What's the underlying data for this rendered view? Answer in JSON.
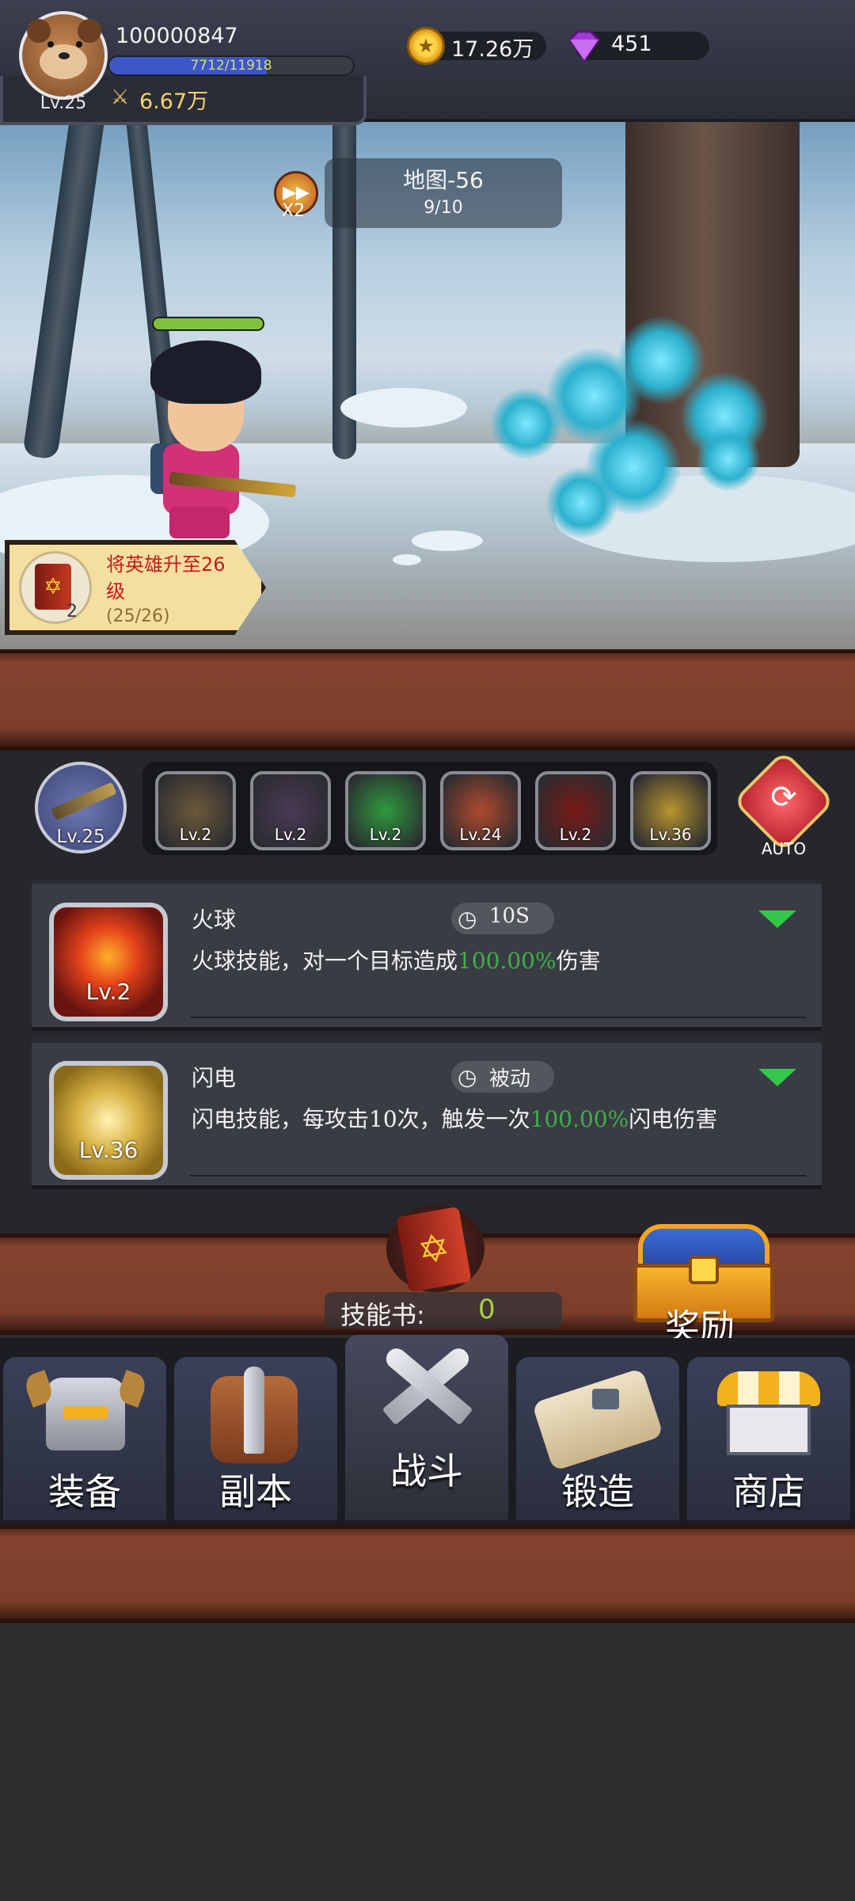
{
  "player": {
    "id": "100000847",
    "level": "Lv.25",
    "exp_text": "7712/11918",
    "exp_fraction": 0.647,
    "power": "6.67万",
    "gold": "17.26万",
    "gems": "451"
  },
  "stage": {
    "speed_label": "X2",
    "map_name": "地图-56",
    "progress": "9/10"
  },
  "hero": {
    "hp_fraction": 1.0
  },
  "quest": {
    "title": "将英雄升至26级",
    "progress": "(25/26)",
    "count": "2"
  },
  "weapon": {
    "level": "Lv.25"
  },
  "skill_tray": [
    {
      "name": "skill-slot-1",
      "level": "Lv.2",
      "color": "#6b5a3a"
    },
    {
      "name": "skill-slot-2",
      "level": "Lv.2",
      "color": "#4a3a55"
    },
    {
      "name": "skill-slot-3",
      "level": "Lv.2",
      "color": "#2f9a3e"
    },
    {
      "name": "skill-slot-4",
      "level": "Lv.24",
      "color": "#b04a2e"
    },
    {
      "name": "skill-slot-5",
      "level": "Lv.2",
      "color": "#7a1a16"
    },
    {
      "name": "skill-slot-6",
      "level": "Lv.36",
      "color": "#b89530"
    }
  ],
  "auto_label": "AUTO",
  "skills": [
    {
      "name": "火球",
      "cooldown": "10S",
      "level": "Lv.2",
      "desc_before": "火球技能，对一个目标造成",
      "desc_highlight": "100.00%",
      "desc_after": "伤害"
    },
    {
      "name": "闪电",
      "cooldown": "被动",
      "level": "Lv.36",
      "desc_before": "闪电技能，每攻击10次，触发一次",
      "desc_highlight": "100.00%",
      "desc_after": "闪电伤害"
    }
  ],
  "skillbook": {
    "label": "技能书:",
    "count": "0"
  },
  "reward_label": "奖励",
  "nav": [
    {
      "label": "装备"
    },
    {
      "label": "副本"
    },
    {
      "label": "战斗"
    },
    {
      "label": "锻造"
    },
    {
      "label": "商店"
    }
  ],
  "colors": {
    "highlight": "#3fae4a",
    "accent_green": "#33c84a",
    "wood": "#7b3f2a"
  }
}
